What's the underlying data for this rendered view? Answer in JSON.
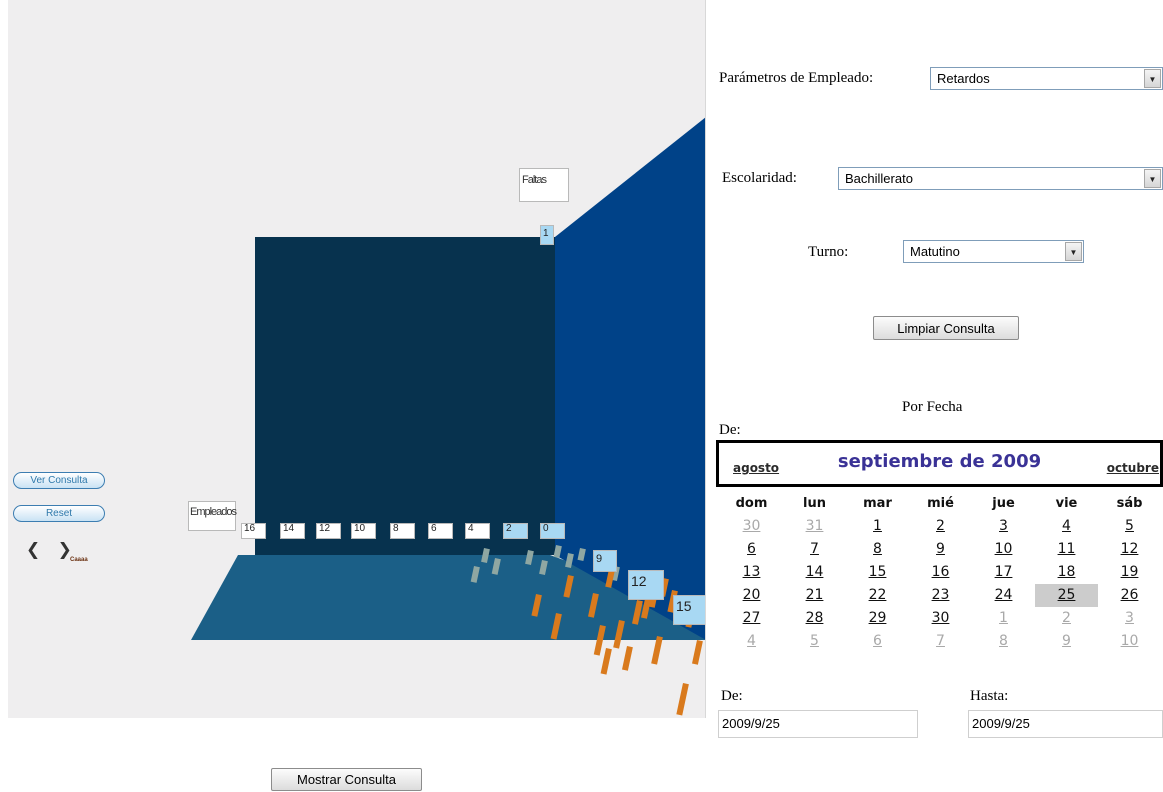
{
  "colors": {
    "back_wall": "#07324e",
    "side_wall": "#004288",
    "floor": "#1b5f87",
    "bar_orange": "#d97a1d",
    "bar_gray": "#8fa7a2",
    "tick_bg": "#a8d8f3",
    "calendar_title": "#3a3296",
    "selected_day_bg": "#cccccc"
  },
  "viewport": {
    "y_axis_label": "Faltas",
    "x_axis_label": "Empleados",
    "y_ticks": [
      "1",
      "9",
      "12",
      "15"
    ],
    "x_ticks": [
      "16",
      "14",
      "12",
      "10",
      "8",
      "6",
      "4",
      "2",
      "0"
    ],
    "controls": {
      "ver_consulta": "Ver Consulta",
      "reset": "Reset",
      "arrows": "❮ ❯",
      "arrows_caption": "Caaaa"
    }
  },
  "right_panel": {
    "parametros_label": "Parámetros de Empleado:",
    "parametros_value": "Retardos",
    "escolaridad_label": "Escolaridad:",
    "escolaridad_value": "Bachillerato",
    "turno_label": "Turno:",
    "turno_value": "Matutino",
    "limpiar_label": "Limpiar Consulta",
    "por_fecha_label": "Por Fecha",
    "de_label_top": "De:"
  },
  "calendar": {
    "prev_label": "agosto",
    "title": "septiembre de 2009",
    "next_label": "octubre",
    "weekdays": [
      "dom",
      "lun",
      "mar",
      "mié",
      "jue",
      "vie",
      "sáb"
    ],
    "weeks": [
      [
        {
          "d": "30",
          "o": true
        },
        {
          "d": "31",
          "o": true
        },
        {
          "d": "1"
        },
        {
          "d": "2"
        },
        {
          "d": "3"
        },
        {
          "d": "4"
        },
        {
          "d": "5"
        }
      ],
      [
        {
          "d": "6"
        },
        {
          "d": "7"
        },
        {
          "d": "8"
        },
        {
          "d": "9"
        },
        {
          "d": "10"
        },
        {
          "d": "11"
        },
        {
          "d": "12"
        }
      ],
      [
        {
          "d": "13"
        },
        {
          "d": "14"
        },
        {
          "d": "15"
        },
        {
          "d": "16"
        },
        {
          "d": "17"
        },
        {
          "d": "18"
        },
        {
          "d": "19"
        }
      ],
      [
        {
          "d": "20"
        },
        {
          "d": "21"
        },
        {
          "d": "22"
        },
        {
          "d": "23"
        },
        {
          "d": "24"
        },
        {
          "d": "25",
          "s": true
        },
        {
          "d": "26"
        }
      ],
      [
        {
          "d": "27"
        },
        {
          "d": "28"
        },
        {
          "d": "29"
        },
        {
          "d": "30"
        },
        {
          "d": "1",
          "o": true
        },
        {
          "d": "2",
          "o": true
        },
        {
          "d": "3",
          "o": true
        }
      ],
      [
        {
          "d": "4",
          "o": true
        },
        {
          "d": "5",
          "o": true
        },
        {
          "d": "6",
          "o": true
        },
        {
          "d": "7",
          "o": true
        },
        {
          "d": "8",
          "o": true
        },
        {
          "d": "9",
          "o": true
        },
        {
          "d": "10",
          "o": true
        }
      ]
    ]
  },
  "date_range": {
    "de_label": "De:",
    "de_value": "2009/9/25",
    "hasta_label": "Hasta:",
    "hasta_value": "2009/9/25"
  },
  "bottom": {
    "mostrar_label": "Mostrar Consulta"
  }
}
